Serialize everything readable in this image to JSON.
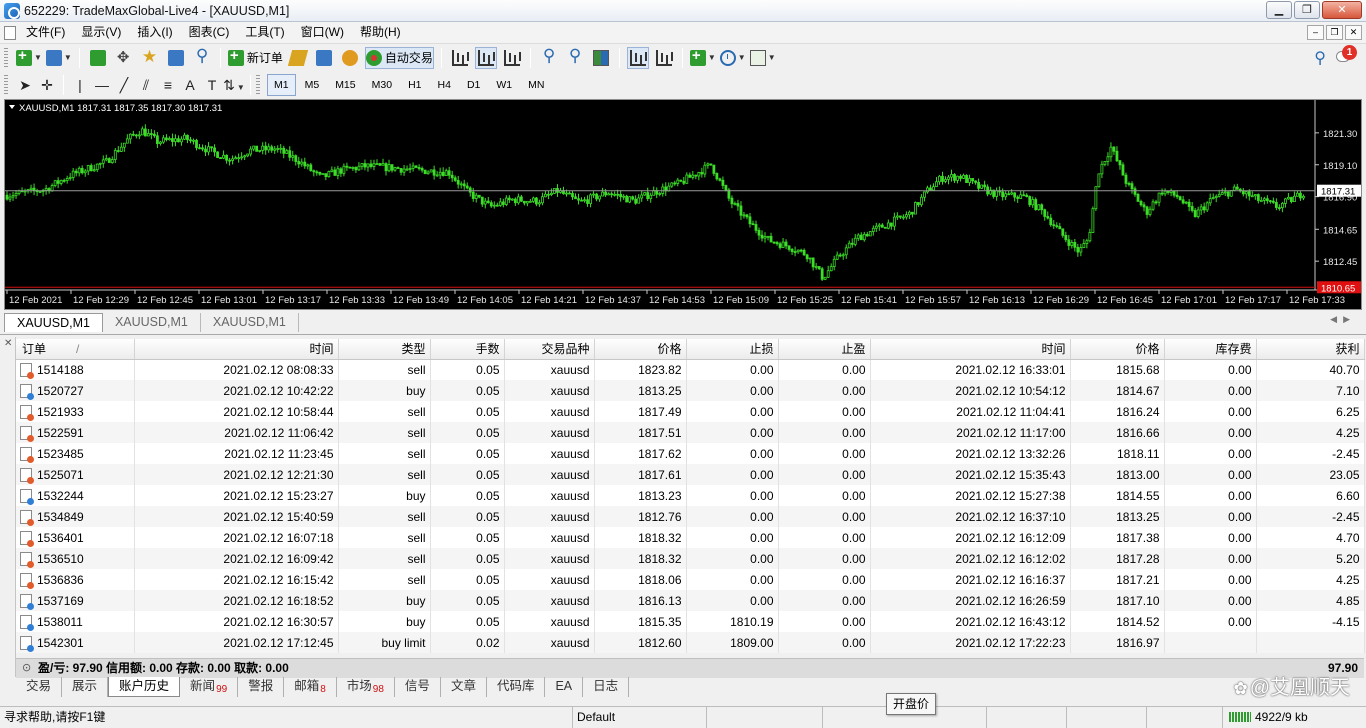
{
  "window": {
    "title": "652229: TradeMaxGlobal-Live4 - [XAUUSD,M1]",
    "minimize_label": "▁",
    "maximize_label": "❐",
    "close_label": "✕"
  },
  "menu": {
    "items": [
      "文件(F)",
      "显示(V)",
      "插入(I)",
      "图表(C)",
      "工具(T)",
      "窗口(W)",
      "帮助(H)"
    ],
    "mdi_minimize": "–",
    "mdi_restore": "❐",
    "mdi_close": "✕"
  },
  "toolbar": {
    "new_order_label": "新订单",
    "auto_trading_label": "自动交易",
    "timeframes": [
      "M1",
      "M5",
      "M15",
      "M30",
      "H1",
      "H4",
      "D1",
      "W1",
      "MN"
    ],
    "active_timeframe": "M1",
    "notifications_count": "1"
  },
  "chart": {
    "header": "XAUUSD,M1  1817.31 1817.35 1817.30 1817.31",
    "background": "#000000",
    "candle_color": "#3cdc28",
    "bid_line_color": "#9a9a9a",
    "ask_line_color": "#d01010"
  },
  "chart_data": {
    "type": "candlestick",
    "symbol": "XAUUSD",
    "timeframe": "M1",
    "ohlc_header": {
      "open": 1817.31,
      "high": 1817.35,
      "low": 1817.3,
      "close": 1817.31
    },
    "ylim": [
      1810.6,
      1822.6
    ],
    "y_ticks": [
      "1821.30",
      "1819.10",
      "1816.90",
      "1814.65",
      "1812.45"
    ],
    "bid_label": "1817.31",
    "ask_label": "1810.65",
    "bid": 1817.31,
    "ask": 1810.65,
    "x_ticks": [
      "12 Feb 2021",
      "12 Feb 12:29",
      "12 Feb 12:45",
      "12 Feb 13:01",
      "12 Feb 13:17",
      "12 Feb 13:33",
      "12 Feb 13:49",
      "12 Feb 14:05",
      "12 Feb 14:21",
      "12 Feb 14:37",
      "12 Feb 14:53",
      "12 Feb 15:09",
      "12 Feb 15:25",
      "12 Feb 15:41",
      "12 Feb 15:57",
      "12 Feb 16:13",
      "12 Feb 16:29",
      "12 Feb 16:45",
      "12 Feb 17:01",
      "12 Feb 17:17",
      "12 Feb 17:33"
    ],
    "close_path": [
      {
        "t": 0,
        "y": 1817.0
      },
      {
        "t": 0.6,
        "y": 1817.4
      },
      {
        "t": 1.0,
        "y": 1818.4
      },
      {
        "t": 1.55,
        "y": 1819.3
      },
      {
        "t": 1.9,
        "y": 1820.9
      },
      {
        "t": 2.1,
        "y": 1821.5
      },
      {
        "t": 2.35,
        "y": 1820.7
      },
      {
        "t": 2.8,
        "y": 1820.9
      },
      {
        "t": 3.2,
        "y": 1820.0
      },
      {
        "t": 3.5,
        "y": 1819.5
      },
      {
        "t": 3.8,
        "y": 1820.1
      },
      {
        "t": 4.2,
        "y": 1820.2
      },
      {
        "t": 4.55,
        "y": 1819.4
      },
      {
        "t": 4.9,
        "y": 1818.2
      },
      {
        "t": 5.2,
        "y": 1818.7
      },
      {
        "t": 5.6,
        "y": 1819.0
      },
      {
        "t": 6.0,
        "y": 1818.9
      },
      {
        "t": 6.5,
        "y": 1818.7
      },
      {
        "t": 6.9,
        "y": 1818.6
      },
      {
        "t": 7.2,
        "y": 1817.2
      },
      {
        "t": 7.55,
        "y": 1816.2
      },
      {
        "t": 7.9,
        "y": 1816.7
      },
      {
        "t": 8.3,
        "y": 1816.6
      },
      {
        "t": 8.6,
        "y": 1817.3
      },
      {
        "t": 8.95,
        "y": 1816.5
      },
      {
        "t": 9.4,
        "y": 1817.2
      },
      {
        "t": 9.8,
        "y": 1816.6
      },
      {
        "t": 10.1,
        "y": 1817.2
      },
      {
        "t": 10.5,
        "y": 1817.8
      },
      {
        "t": 11.0,
        "y": 1819.1
      },
      {
        "t": 11.3,
        "y": 1816.6
      },
      {
        "t": 11.6,
        "y": 1815.1
      },
      {
        "t": 11.9,
        "y": 1813.9
      },
      {
        "t": 12.2,
        "y": 1813.5
      },
      {
        "t": 12.5,
        "y": 1812.9
      },
      {
        "t": 12.75,
        "y": 1811.3
      },
      {
        "t": 13.0,
        "y": 1812.8
      },
      {
        "t": 13.3,
        "y": 1814.1
      },
      {
        "t": 13.7,
        "y": 1814.9
      },
      {
        "t": 14.1,
        "y": 1815.7
      },
      {
        "t": 14.4,
        "y": 1817.4
      },
      {
        "t": 14.6,
        "y": 1818.2
      },
      {
        "t": 14.9,
        "y": 1818.3
      },
      {
        "t": 15.2,
        "y": 1817.5
      },
      {
        "t": 15.5,
        "y": 1817.0
      },
      {
        "t": 15.9,
        "y": 1816.9
      },
      {
        "t": 16.2,
        "y": 1815.8
      },
      {
        "t": 16.5,
        "y": 1814.2
      },
      {
        "t": 16.75,
        "y": 1813.1
      },
      {
        "t": 16.9,
        "y": 1814.0
      },
      {
        "t": 17.05,
        "y": 1818.6
      },
      {
        "t": 17.25,
        "y": 1820.3
      },
      {
        "t": 17.5,
        "y": 1817.8
      },
      {
        "t": 17.8,
        "y": 1815.8
      },
      {
        "t": 18.05,
        "y": 1817.3
      },
      {
        "t": 18.3,
        "y": 1816.9
      },
      {
        "t": 18.55,
        "y": 1815.6
      },
      {
        "t": 18.85,
        "y": 1816.8
      },
      {
        "t": 19.2,
        "y": 1817.4
      },
      {
        "t": 19.55,
        "y": 1816.7
      },
      {
        "t": 19.85,
        "y": 1816.2
      },
      {
        "t": 20.15,
        "y": 1816.9
      },
      {
        "t": 20.3,
        "y": 1817.31
      }
    ]
  },
  "chart_tabs": [
    "XAUUSD,M1",
    "XAUUSD,M1",
    "XAUUSD,M1"
  ],
  "history_table": {
    "columns": [
      "订单",
      "时间",
      "类型",
      "手数",
      "交易品种",
      "价格",
      "止损",
      "止盈",
      "时间",
      "价格",
      "库存费",
      "获利"
    ],
    "sort_indicator": "/",
    "rows": [
      [
        "1514188",
        "2021.02.12 08:08:33",
        "sell",
        "0.05",
        "xauusd",
        "1823.82",
        "0.00",
        "0.00",
        "2021.02.12 16:33:01",
        "1815.68",
        "0.00",
        "40.70"
      ],
      [
        "1520727",
        "2021.02.12 10:42:22",
        "buy",
        "0.05",
        "xauusd",
        "1813.25",
        "0.00",
        "0.00",
        "2021.02.12 10:54:12",
        "1814.67",
        "0.00",
        "7.10"
      ],
      [
        "1521933",
        "2021.02.12 10:58:44",
        "sell",
        "0.05",
        "xauusd",
        "1817.49",
        "0.00",
        "0.00",
        "2021.02.12 11:04:41",
        "1816.24",
        "0.00",
        "6.25"
      ],
      [
        "1522591",
        "2021.02.12 11:06:42",
        "sell",
        "0.05",
        "xauusd",
        "1817.51",
        "0.00",
        "0.00",
        "2021.02.12 11:17:00",
        "1816.66",
        "0.00",
        "4.25"
      ],
      [
        "1523485",
        "2021.02.12 11:23:45",
        "sell",
        "0.05",
        "xauusd",
        "1817.62",
        "0.00",
        "0.00",
        "2021.02.12 13:32:26",
        "1818.11",
        "0.00",
        "-2.45"
      ],
      [
        "1525071",
        "2021.02.12 12:21:30",
        "sell",
        "0.05",
        "xauusd",
        "1817.61",
        "0.00",
        "0.00",
        "2021.02.12 15:35:43",
        "1813.00",
        "0.00",
        "23.05"
      ],
      [
        "1532244",
        "2021.02.12 15:23:27",
        "buy",
        "0.05",
        "xauusd",
        "1813.23",
        "0.00",
        "0.00",
        "2021.02.12 15:27:38",
        "1814.55",
        "0.00",
        "6.60"
      ],
      [
        "1534849",
        "2021.02.12 15:40:59",
        "sell",
        "0.05",
        "xauusd",
        "1812.76",
        "0.00",
        "0.00",
        "2021.02.12 16:37:10",
        "1813.25",
        "0.00",
        "-2.45"
      ],
      [
        "1536401",
        "2021.02.12 16:07:18",
        "sell",
        "0.05",
        "xauusd",
        "1818.32",
        "0.00",
        "0.00",
        "2021.02.12 16:12:09",
        "1817.38",
        "0.00",
        "4.70"
      ],
      [
        "1536510",
        "2021.02.12 16:09:42",
        "sell",
        "0.05",
        "xauusd",
        "1818.32",
        "0.00",
        "0.00",
        "2021.02.12 16:12:02",
        "1817.28",
        "0.00",
        "5.20"
      ],
      [
        "1536836",
        "2021.02.12 16:15:42",
        "sell",
        "0.05",
        "xauusd",
        "1818.06",
        "0.00",
        "0.00",
        "2021.02.12 16:16:37",
        "1817.21",
        "0.00",
        "4.25"
      ],
      [
        "1537169",
        "2021.02.12 16:18:52",
        "buy",
        "0.05",
        "xauusd",
        "1816.13",
        "0.00",
        "0.00",
        "2021.02.12 16:26:59",
        "1817.10",
        "0.00",
        "4.85"
      ],
      [
        "1538011",
        "2021.02.12 16:30:57",
        "buy",
        "0.05",
        "xauusd",
        "1815.35",
        "1810.19",
        "0.00",
        "2021.02.12 16:43:12",
        "1814.52",
        "0.00",
        "-4.15"
      ],
      [
        "1542301",
        "2021.02.12 17:12:45",
        "buy limit",
        "0.02",
        "xauusd",
        "1812.60",
        "1809.00",
        "0.00",
        "2021.02.12 17:22:23",
        "1816.97",
        "",
        ""
      ]
    ],
    "summary": "盈/亏: 97.90  信用额: 0.00  存款: 0.00  取款: 0.00",
    "summary_total": "97.90"
  },
  "terminal_tabs": [
    {
      "label": "交易",
      "badge": ""
    },
    {
      "label": "展示",
      "badge": ""
    },
    {
      "label": "账户历史",
      "badge": "",
      "active": true
    },
    {
      "label": "新闻",
      "badge": "99"
    },
    {
      "label": "警报",
      "badge": ""
    },
    {
      "label": "邮箱",
      "badge": "8"
    },
    {
      "label": "市场",
      "badge": "98"
    },
    {
      "label": "信号",
      "badge": ""
    },
    {
      "label": "文章",
      "badge": ""
    },
    {
      "label": "代码库",
      "badge": ""
    },
    {
      "label": "EA",
      "badge": ""
    },
    {
      "label": "日志",
      "badge": ""
    }
  ],
  "watermark": "@艾凰顺天",
  "tooltip": "开盘价",
  "statusbar": {
    "help": "寻求帮助,请按F1键",
    "profile": "Default",
    "connection": "4922/9 kb"
  }
}
